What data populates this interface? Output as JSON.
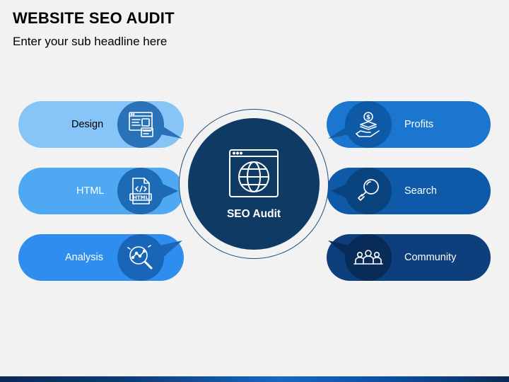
{
  "header": {
    "title": "WEBSITE SEO AUDIT",
    "subtitle": "Enter your sub headline here"
  },
  "hub": {
    "label": "SEO Audit",
    "icon": "globe-browser-icon",
    "color": "#0e3a64"
  },
  "left_items": [
    {
      "label": "Design",
      "icon": "web-design-icon",
      "pill_color": "#87c4f7",
      "circle_color": "#2a72b8",
      "text_color": "#000000"
    },
    {
      "label": "HTML",
      "icon": "html-file-icon",
      "pill_color": "#4ea8f2",
      "circle_color": "#1d6ab5",
      "text_color": "#ffffff"
    },
    {
      "label": "Analysis",
      "icon": "analysis-magnifier-icon",
      "pill_color": "#2f8df0",
      "circle_color": "#1966b8",
      "text_color": "#ffffff"
    }
  ],
  "right_items": [
    {
      "label": "Profits",
      "icon": "money-hand-icon",
      "pill_color": "#1a76cf",
      "circle_color": "#0f5aa6",
      "text_color": "#ffffff"
    },
    {
      "label": "Search",
      "icon": "search-icon",
      "pill_color": "#0e5aa9",
      "circle_color": "#0a447f",
      "text_color": "#ffffff"
    },
    {
      "label": "Community",
      "icon": "community-people-icon",
      "pill_color": "#0c3f7c",
      "circle_color": "#082c57",
      "text_color": "#ffffff"
    }
  ]
}
